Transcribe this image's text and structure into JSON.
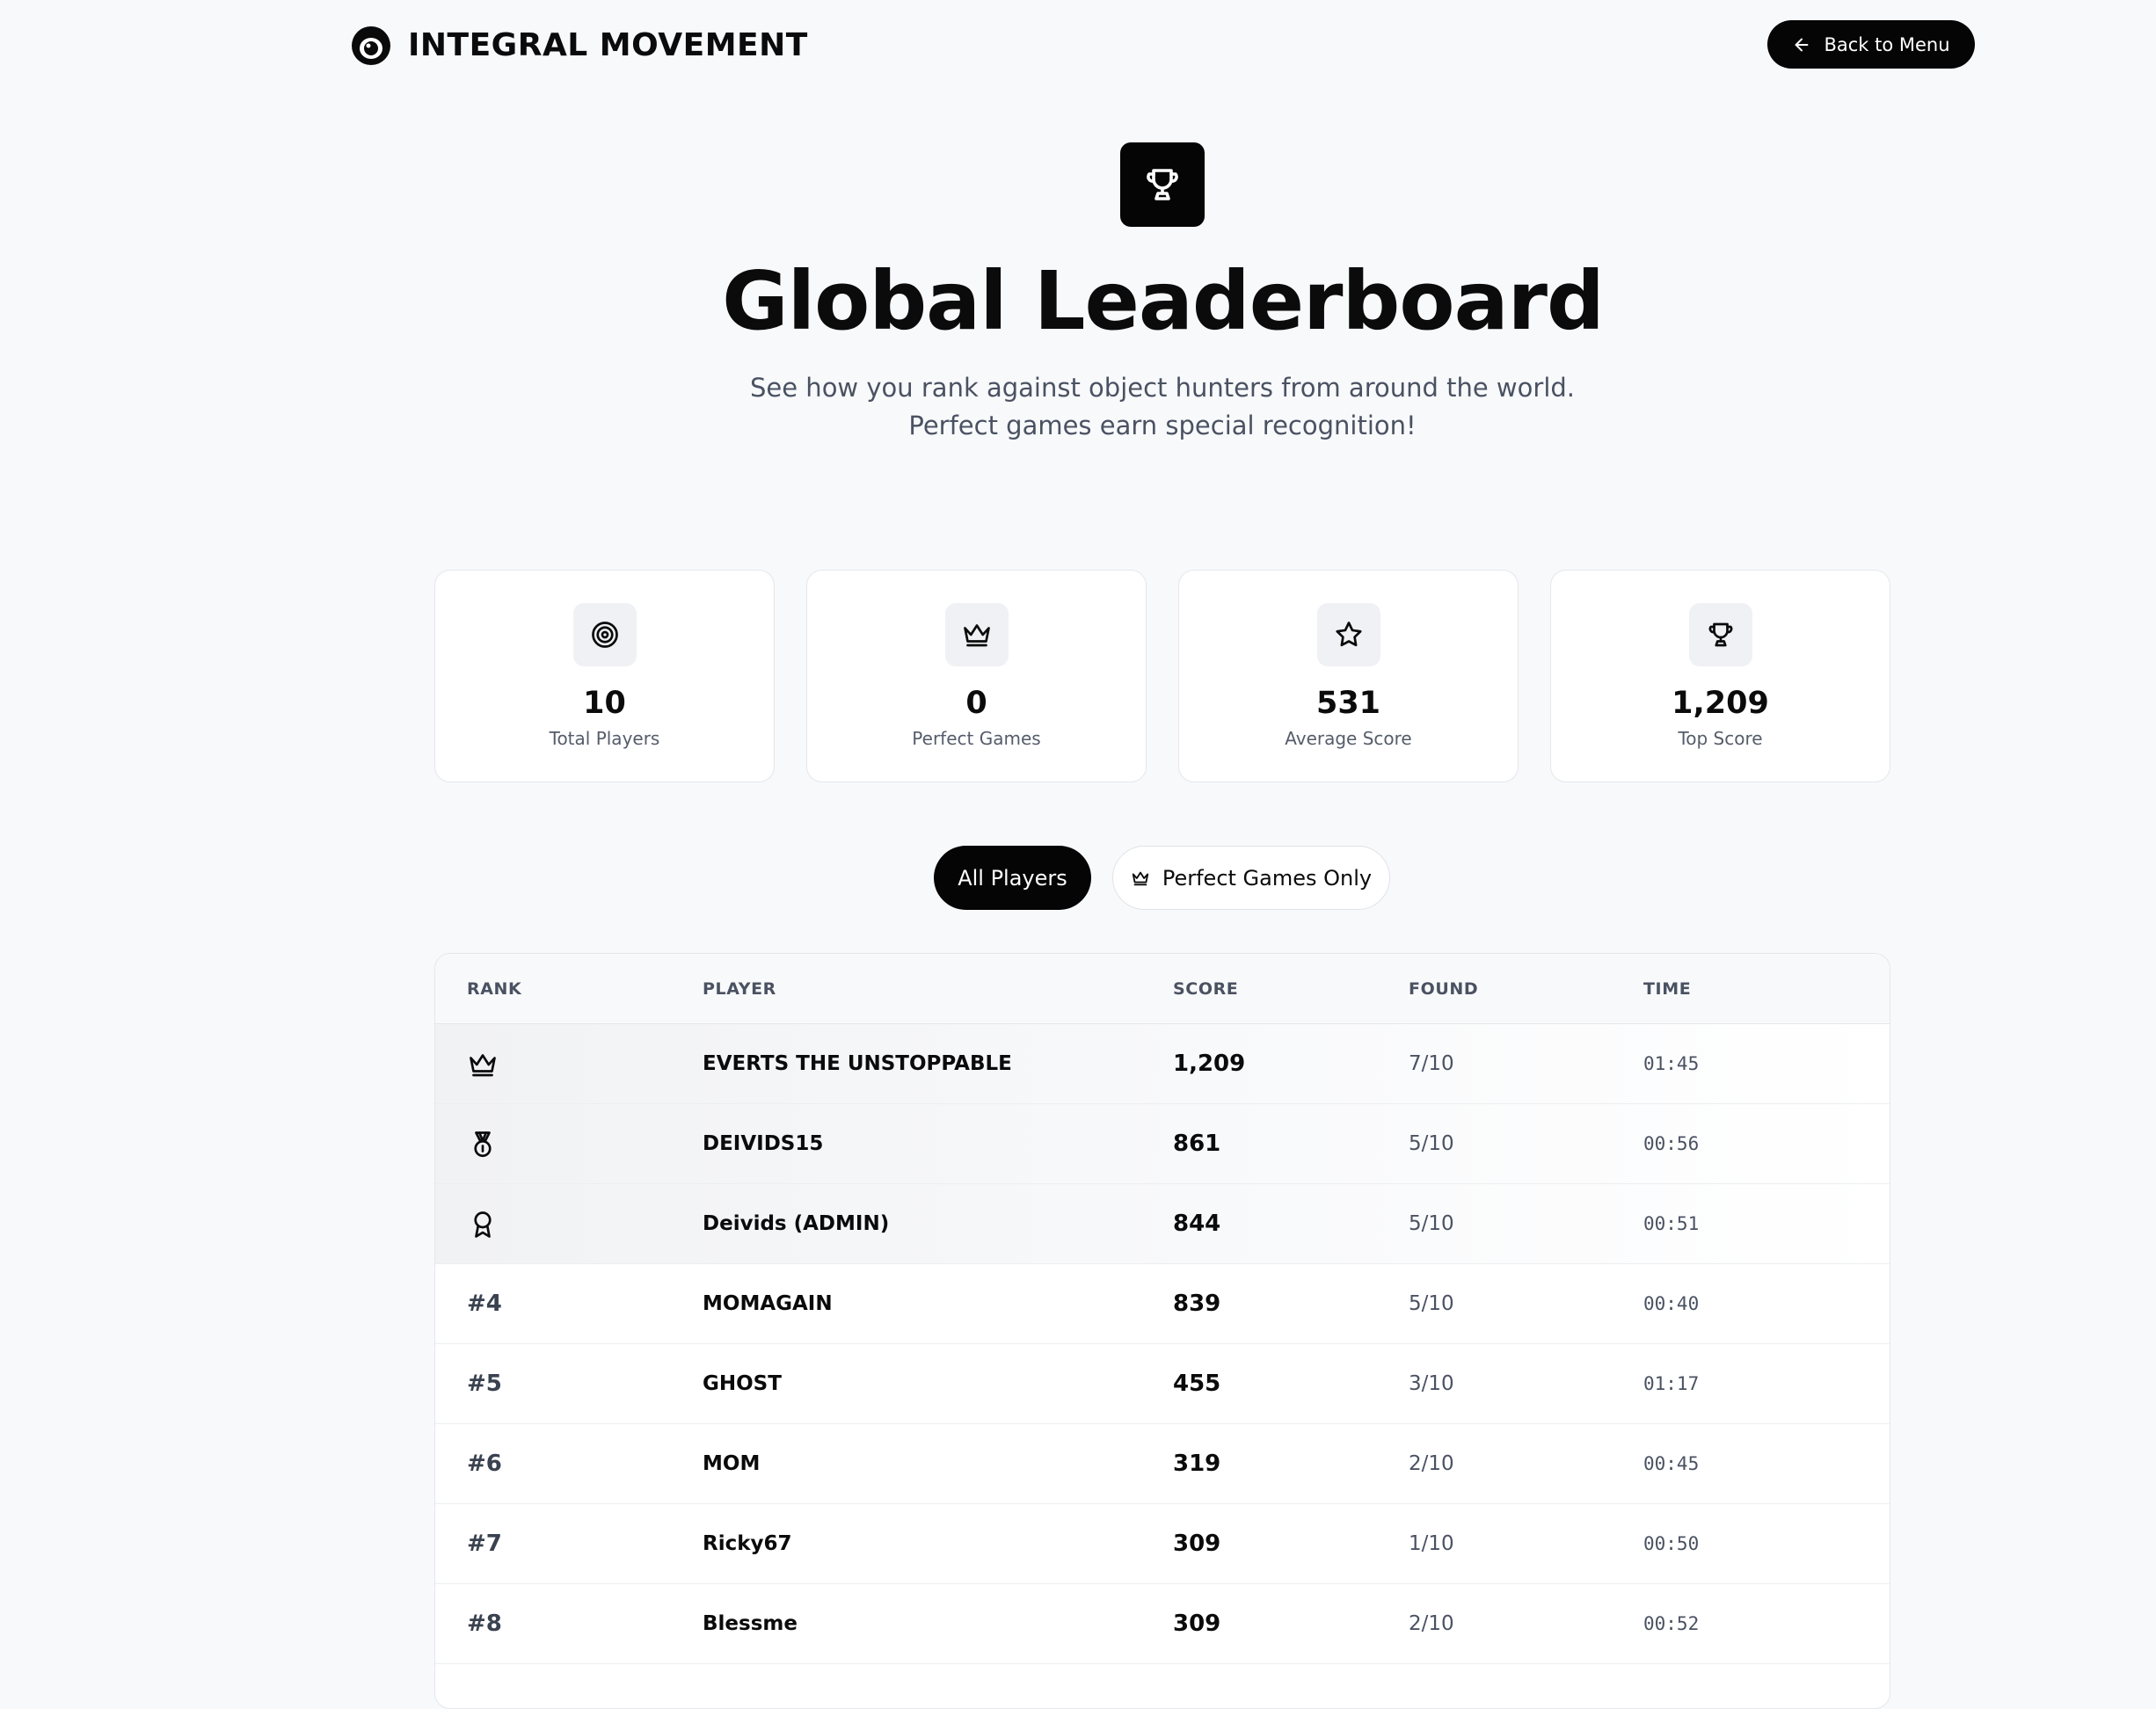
{
  "header": {
    "brand": "INTEGRAL MOVEMENT",
    "logo_icon": "eye-logo",
    "back_label": "Back to Menu",
    "back_icon": "arrow-left-icon"
  },
  "hero": {
    "icon": "trophy-icon",
    "title": "Global Leaderboard",
    "subtitle": "See how you rank against object hunters from around the world. Perfect games earn special recognition!"
  },
  "stats": [
    {
      "icon": "target-icon",
      "value": "10",
      "label": "Total Players"
    },
    {
      "icon": "crown-icon",
      "value": "0",
      "label": "Perfect Games"
    },
    {
      "icon": "star-icon",
      "value": "531",
      "label": "Average Score"
    },
    {
      "icon": "trophy-icon",
      "value": "1,209",
      "label": "Top Score"
    }
  ],
  "filters": {
    "all_label": "All Players",
    "perfect_label": "Perfect Games Only",
    "perfect_icon": "crown-icon",
    "active": "All Players"
  },
  "table": {
    "columns": [
      "RANK",
      "PLAYER",
      "SCORE",
      "FOUND",
      "TIME"
    ],
    "rows": [
      {
        "rank": "",
        "rank_icon": "crown-icon",
        "player": "EVERTS THE UNSTOPPABLE",
        "score": "1,209",
        "found": "7/10",
        "time": "01:45"
      },
      {
        "rank": "",
        "rank_icon": "medal-icon",
        "player": "DEIVIDS15",
        "score": "861",
        "found": "5/10",
        "time": "00:56"
      },
      {
        "rank": "",
        "rank_icon": "award-icon",
        "player": "Deivids (ADMIN)",
        "score": "844",
        "found": "5/10",
        "time": "00:51"
      },
      {
        "rank": "#4",
        "rank_icon": "",
        "player": "MOMAGAIN",
        "score": "839",
        "found": "5/10",
        "time": "00:40"
      },
      {
        "rank": "#5",
        "rank_icon": "",
        "player": "GHOST",
        "score": "455",
        "found": "3/10",
        "time": "01:17"
      },
      {
        "rank": "#6",
        "rank_icon": "",
        "player": "MOM",
        "score": "319",
        "found": "2/10",
        "time": "00:45"
      },
      {
        "rank": "#7",
        "rank_icon": "",
        "player": "Ricky67",
        "score": "309",
        "found": "1/10",
        "time": "00:50"
      },
      {
        "rank": "#8",
        "rank_icon": "",
        "player": "Blessme",
        "score": "309",
        "found": "2/10",
        "time": "00:52"
      }
    ]
  },
  "colors": {
    "background": "#f8f9fb",
    "primary": "#050505",
    "card": "#ffffff",
    "muted_text": "#4a5262",
    "border": "#e4e7ec"
  }
}
